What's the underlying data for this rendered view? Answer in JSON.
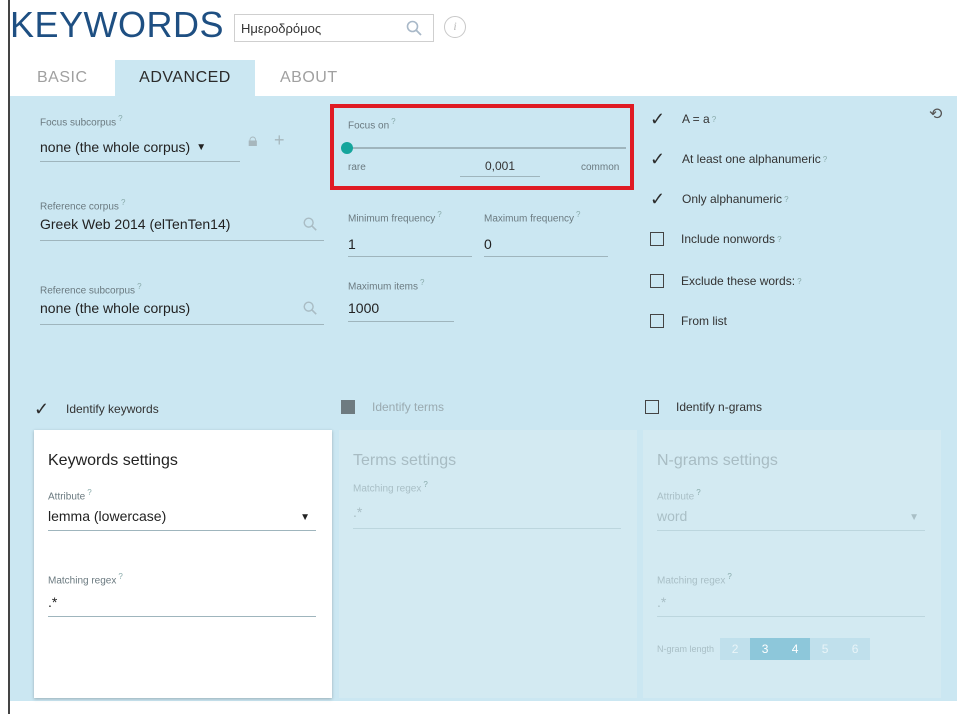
{
  "app": {
    "title": "KEYWORDS"
  },
  "search": {
    "value": "Ημεροδρόμος"
  },
  "tabs": [
    {
      "label": "BASIC"
    },
    {
      "label": "ADVANCED"
    },
    {
      "label": "ABOUT"
    }
  ],
  "sup_mark": "?",
  "focus_subcorpus": {
    "label": "Focus subcorpus",
    "value": "none (the whole corpus)"
  },
  "reference_corpus": {
    "label": "Reference corpus",
    "value": "Greek Web 2014 (elTenTen14)"
  },
  "reference_subcorpus": {
    "label": "Reference subcorpus",
    "value": "none (the whole corpus)"
  },
  "focus_on": {
    "label": "Focus on",
    "left_label": "rare",
    "right_label": "common",
    "value": "0,001",
    "level": 0.0
  },
  "min_frequency": {
    "label": "Minimum frequency",
    "value": "1"
  },
  "max_frequency": {
    "label": "Maximum frequency",
    "value": "0"
  },
  "max_items": {
    "label": "Maximum items",
    "value": "1000"
  },
  "options": [
    {
      "label": "A = a",
      "checked": true
    },
    {
      "label": "At least one alphanumeric",
      "checked": true
    },
    {
      "label": "Only alphanumeric",
      "checked": true
    },
    {
      "label": "Include nonwords",
      "checked": false
    },
    {
      "label": "Exclude these words:",
      "checked": false
    },
    {
      "label": "From list",
      "checked": false
    }
  ],
  "identify": {
    "keywords": {
      "label": "Identify keywords",
      "checked": true
    },
    "terms": {
      "label": "Identify terms",
      "checked": "disabled"
    },
    "ngrams": {
      "label": "Identify n-grams",
      "checked": false
    }
  },
  "keywords_settings": {
    "title": "Keywords settings",
    "attribute_label": "Attribute",
    "attribute_value": "lemma (lowercase)",
    "regex_label": "Matching regex",
    "regex_value": ".*"
  },
  "terms_settings": {
    "title": "Terms settings",
    "regex_label": "Matching regex",
    "regex_value": ".*"
  },
  "ngrams_settings": {
    "title": "N-grams settings",
    "attribute_label": "Attribute",
    "attribute_value": "word",
    "regex_label": "Matching regex",
    "regex_value": ".*",
    "length_label": "N-gram length",
    "lengths": [
      "2",
      "3",
      "4",
      "5",
      "6"
    ],
    "selected": [
      "3",
      "4"
    ]
  },
  "colors": {
    "accent": "#15a59c",
    "panel": "#cbe7f2",
    "title": "#1e4f82",
    "highlight": "#e01b24"
  }
}
